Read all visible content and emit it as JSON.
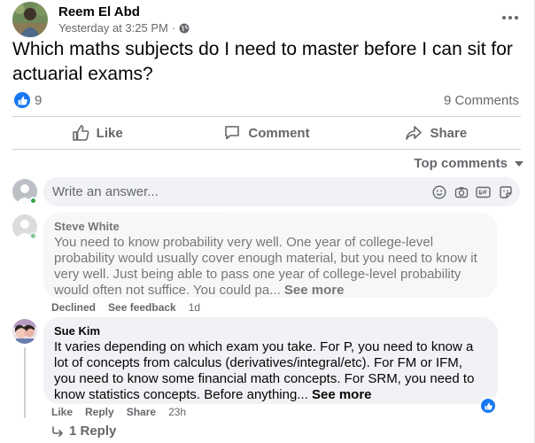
{
  "post": {
    "author": "Reem El Abd",
    "timestamp": "Yesterday at 3:25 PM",
    "separator": "·",
    "text": "Which maths subjects do I need to master before I can sit for actuarial exams?",
    "reaction_count": "9",
    "comment_count": "9 Comments"
  },
  "actions": {
    "like": "Like",
    "comment": "Comment",
    "share": "Share"
  },
  "sort": {
    "label": "Top comments"
  },
  "composer": {
    "placeholder": "Write an answer..."
  },
  "comments": [
    {
      "author": "Steve White",
      "text": "You need to know probability very well. One year of college-level probability would usually cover enough material, but you need to know it very well. Just being able to pass one year of college-level probability would often not suffice. You could pa...",
      "see_more": "See more",
      "status": "Declined",
      "feedback": "See feedback",
      "time": "1d"
    },
    {
      "author": "Sue Kim",
      "text": "It varies depending on which exam you take. For P, you need to know a lot of concepts from calculus (derivatives/integral/etc). For FM or IFM, you need to know some financial math concepts. For SRM, you need to know statistics concepts. Before anything...",
      "see_more": "See more",
      "like": "Like",
      "reply": "Reply",
      "share": "Share",
      "time": "23h",
      "replies": "1 Reply"
    }
  ],
  "icons": {
    "globe": "globe-icon",
    "more": "more-icon",
    "like": "thumbs-up-icon",
    "comment": "comment-icon",
    "share": "share-icon",
    "emoji": "emoji-icon",
    "camera": "camera-icon",
    "gif": "gif-icon",
    "sticker": "sticker-icon",
    "reply_arrow": "reply-arrow-icon"
  },
  "colors": {
    "accent": "#1877f2",
    "secondary_text": "#65676b",
    "bubble": "#f0f2f5",
    "online": "#31a24c"
  }
}
